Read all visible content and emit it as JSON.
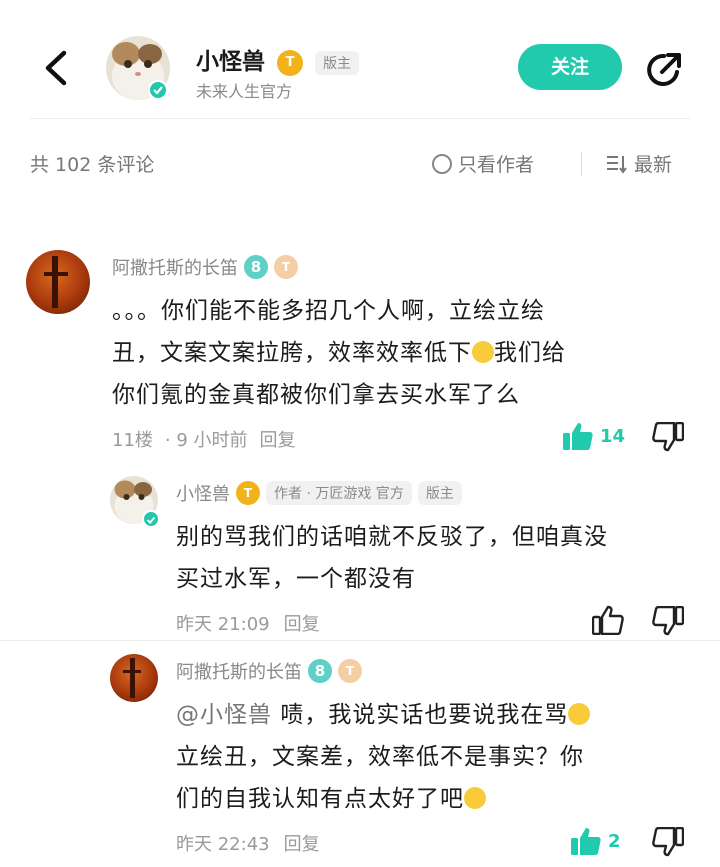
{
  "header": {
    "name": "小怪兽",
    "level_badge": "T",
    "moderator_tag": "版主",
    "subtitle": "未来人生官方",
    "follow_label": "关注"
  },
  "filter_bar": {
    "comment_count": "共 102 条评论",
    "only_author": "只看作者",
    "sort": "最新"
  },
  "comments": [
    {
      "name": "阿撒托斯的长笛",
      "badge_8": "8",
      "badge_t": "T",
      "text_line1": "。。。你们能不能多招几个人啊，立绘立绘",
      "text_line2a": "丑，文案文案拉胯，效率效率低下",
      "text_line2b": "我们给",
      "text_line3": "你们氪的金真都被你们拿去买水军了么",
      "floor": "11楼",
      "time": "· 9 小时前",
      "reply": "回复",
      "likes": "14",
      "replies": [
        {
          "name": "小怪兽",
          "badge_t": "T",
          "author_tag": "作者 · 万匠游戏 官方",
          "mod_tag": "版主",
          "text_line1": "别的骂我们的话咱就不反驳了，但咱真没",
          "text_line2": "买过水军，一个都没有",
          "time": "昨天 21:09",
          "reply": "回复"
        },
        {
          "name": "阿撒托斯的长笛",
          "badge_8": "8",
          "badge_t": "T",
          "mention": "@小怪兽",
          "text_line1": "啧，我说实话也要说我在骂",
          "text_line2": "立绘丑，文案差，效率低不是事实？你",
          "text_line3": "们的自我认知有点太好了吧",
          "time": "昨天 22:43",
          "reply": "回复",
          "likes": "2"
        }
      ]
    }
  ],
  "colors": {
    "accent": "#21c9ad",
    "gold": "#f2b21c"
  },
  "icons": [
    "back-arrow-icon",
    "share-icon",
    "verified-icon",
    "thumbs-up-icon",
    "thumbs-down-icon",
    "sort-icon",
    "radio-circle-icon"
  ]
}
